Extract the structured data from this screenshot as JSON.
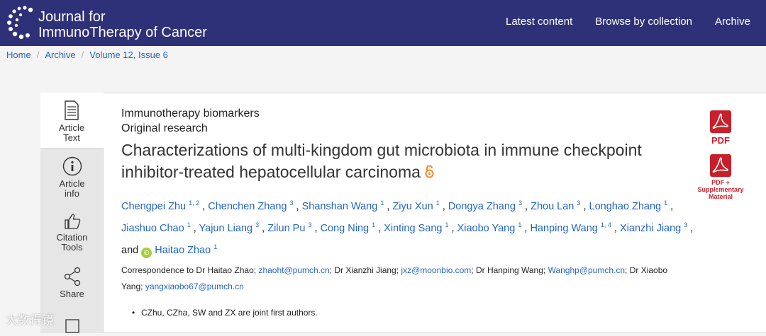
{
  "brand": {
    "line1": "Journal for",
    "line2": "ImmunoTherapy of Cancer"
  },
  "nav": [
    "Latest content",
    "Browse by collection",
    "Archive"
  ],
  "breadcrumb": [
    "Home",
    "Archive",
    "Volume 12, Issue 6"
  ],
  "sidebar": [
    {
      "label": "Article Text",
      "icon": "article-text-icon"
    },
    {
      "label": "Article info",
      "icon": "info-icon"
    },
    {
      "label": "Citation Tools",
      "icon": "thumbs-up-icon"
    },
    {
      "label": "Share",
      "icon": "share-icon"
    }
  ],
  "article": {
    "section": "Immunotherapy biomarkers",
    "type": "Original research",
    "title": "Characterizations of multi-kingdom gut microbiota in immune checkpoint inhibitor-treated hepatocellular carcinoma",
    "authors": [
      {
        "name": "Chengpei Zhu",
        "sup": "1, 2"
      },
      {
        "name": "Chenchen Zhang",
        "sup": "3"
      },
      {
        "name": "Shanshan Wang",
        "sup": "1"
      },
      {
        "name": "Ziyu Xun",
        "sup": "1"
      },
      {
        "name": "Dongya Zhang",
        "sup": "3"
      },
      {
        "name": "Zhou Lan",
        "sup": "3"
      },
      {
        "name": "Longhao Zhang",
        "sup": "1"
      },
      {
        "name": "Jiashuo Chao",
        "sup": "1"
      },
      {
        "name": "Yajun Liang",
        "sup": "3"
      },
      {
        "name": "Zilun Pu",
        "sup": "3"
      },
      {
        "name": "Cong Ning",
        "sup": "1"
      },
      {
        "name": "Xinting Sang",
        "sup": "1"
      },
      {
        "name": "Xiaobo Yang",
        "sup": "1"
      },
      {
        "name": "Hanping Wang",
        "sup": "1, 4"
      },
      {
        "name": "Xianzhi Jiang",
        "sup": "3"
      }
    ],
    "and_text": "and",
    "last_author": {
      "name": "Haitao Zhao",
      "sup": "1"
    },
    "correspondence": {
      "p1": "Correspondence to Dr Haitao Zhao; ",
      "m1": "zhaoht@pumch.cn",
      "p2": "; Dr Xianzhi Jiang; ",
      "m2": "jxz@moonbio.com",
      "p3": "; Dr Hanping Wang; ",
      "m3": "Wanghp@pumch.cn",
      "p4": "; Dr Xiaobo Yang; ",
      "m4": "yangxiaobo67@pumch.cn"
    },
    "footnote": "CZhu, CZha, SW and ZX are joint first authors."
  },
  "pdf": {
    "label": "PDF",
    "supp_line1": "PDF +",
    "supp_line2": "Supplementary",
    "supp_line3": "Material"
  },
  "watermark": "大数得镜",
  "colors": {
    "header": "#2e3178",
    "link": "#2466c2",
    "pdf": "#c8202a"
  }
}
